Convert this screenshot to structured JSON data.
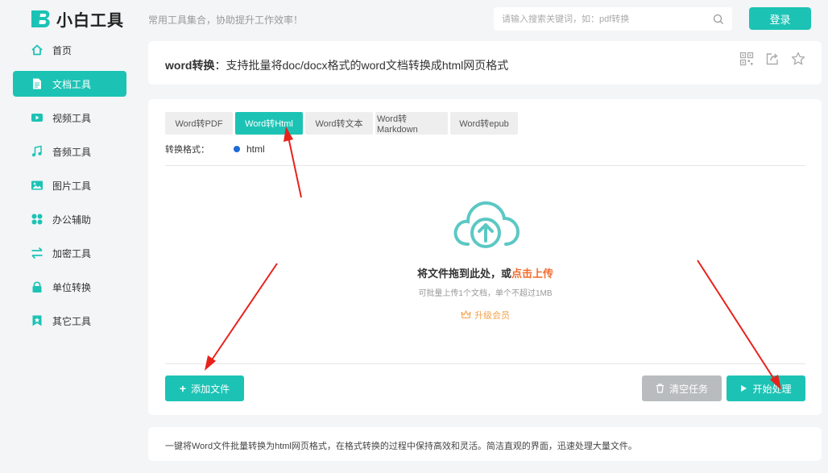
{
  "header": {
    "logo_text": "小白工具",
    "slogan": "常用工具集合，协助提升工作效率！",
    "search_placeholder": "请输入搜索关键词，如：pdf转换",
    "login_label": "登录"
  },
  "sidebar": {
    "items": [
      {
        "label": "首页",
        "icon": "home-icon"
      },
      {
        "label": "文档工具",
        "icon": "document-icon",
        "active": true
      },
      {
        "label": "视频工具",
        "icon": "video-icon"
      },
      {
        "label": "音频工具",
        "icon": "music-icon"
      },
      {
        "label": "图片工具",
        "icon": "image-icon"
      },
      {
        "label": "办公辅助",
        "icon": "apps-icon"
      },
      {
        "label": "加密工具",
        "icon": "swap-icon"
      },
      {
        "label": "单位转换",
        "icon": "lock-icon"
      },
      {
        "label": "其它工具",
        "icon": "bookmark-icon"
      }
    ]
  },
  "title_card": {
    "name": "word转换",
    "sep": "：",
    "description": "支持批量将doc/docx格式的word文档转换成html网页格式"
  },
  "tabs": [
    {
      "label": "Word转PDF"
    },
    {
      "label": "Word转Html",
      "active": true
    },
    {
      "label": "Word转文本"
    },
    {
      "label": "Word转Markdown"
    },
    {
      "label": "Word转epub"
    }
  ],
  "format": {
    "label": "转换格式：",
    "value": "html"
  },
  "dropzone": {
    "title_prefix": "将文件拖到此处，或",
    "title_link": "点击上传",
    "subtitle": "可批量上传1个文档，单个不超过1MB",
    "vip_label": "升级会员"
  },
  "buttons": {
    "add": "添加文件",
    "clear": "清空任务",
    "start": "开始处理"
  },
  "footer_desc": "一键将Word文件批量转换为html网页格式，在格式转换的过程中保持高效和灵活。简洁直观的界面，迅速处理大量文件。",
  "colors": {
    "accent": "#1cc3b5",
    "link": "#f26b2e",
    "vip": "#f5a24b",
    "arrow": "#e8221b"
  }
}
